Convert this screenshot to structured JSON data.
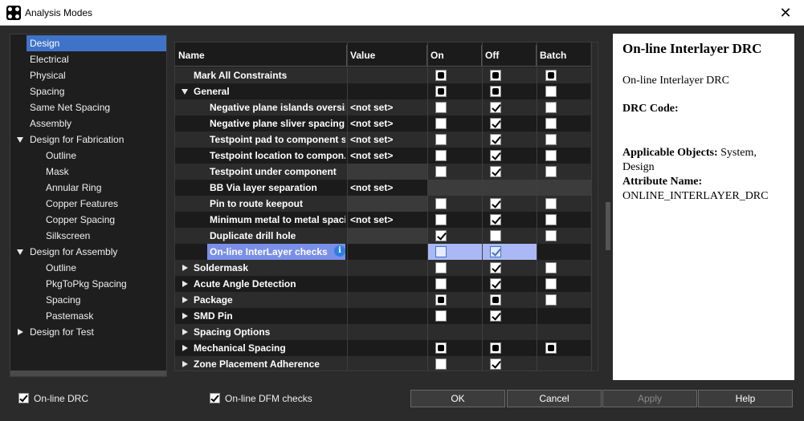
{
  "window": {
    "title": "Analysis Modes",
    "close_symbol": "✕"
  },
  "tree": {
    "items": [
      {
        "label": "Design",
        "level": 0,
        "expander": "none",
        "selected": true
      },
      {
        "label": "Electrical",
        "level": 0,
        "expander": "none"
      },
      {
        "label": "Physical",
        "level": 0,
        "expander": "none"
      },
      {
        "label": "Spacing",
        "level": 0,
        "expander": "none"
      },
      {
        "label": "Same Net Spacing",
        "level": 0,
        "expander": "none"
      },
      {
        "label": "Assembly",
        "level": 0,
        "expander": "none"
      },
      {
        "label": "Design for Fabrication",
        "level": 0,
        "expander": "expanded"
      },
      {
        "label": "Outline",
        "level": 1,
        "expander": "none"
      },
      {
        "label": "Mask",
        "level": 1,
        "expander": "none"
      },
      {
        "label": "Annular Ring",
        "level": 1,
        "expander": "none"
      },
      {
        "label": "Copper Features",
        "level": 1,
        "expander": "none"
      },
      {
        "label": "Copper Spacing",
        "level": 1,
        "expander": "none"
      },
      {
        "label": "Silkscreen",
        "level": 1,
        "expander": "none"
      },
      {
        "label": "Design for Assembly",
        "level": 0,
        "expander": "expanded"
      },
      {
        "label": "Outline",
        "level": 1,
        "expander": "none"
      },
      {
        "label": "PkgToPkg Spacing",
        "level": 1,
        "expander": "none"
      },
      {
        "label": "Spacing",
        "level": 1,
        "expander": "none"
      },
      {
        "label": "Pastemask",
        "level": 1,
        "expander": "none"
      },
      {
        "label": "Design for Test",
        "level": 0,
        "expander": "collapsed"
      }
    ]
  },
  "grid": {
    "columns": [
      "Name",
      "Value",
      "On",
      "Off",
      "Batch"
    ],
    "rows": [
      {
        "name": "Mark All Constraints",
        "indent": 1,
        "arrow": "none",
        "value": "",
        "on": "ind",
        "off": "ind",
        "batch": "ind"
      },
      {
        "name": "General",
        "indent": 1,
        "arrow": "down",
        "value": "",
        "on": "ind",
        "off": "ind",
        "batch": "empty"
      },
      {
        "name": "Negative plane islands oversize",
        "indent": 2,
        "arrow": "none",
        "value": "<not set>",
        "on": "empty",
        "off": "chk",
        "batch": "empty"
      },
      {
        "name": "Negative plane sliver spacing",
        "indent": 2,
        "arrow": "none",
        "value": "<not set>",
        "on": "empty",
        "off": "chk",
        "batch": "empty"
      },
      {
        "name": "Testpoint pad to component s...",
        "indent": 2,
        "arrow": "none",
        "value": "<not set>",
        "on": "empty",
        "off": "chk",
        "batch": "empty"
      },
      {
        "name": "Testpoint location to compon...",
        "indent": 2,
        "arrow": "none",
        "value": "<not set>",
        "on": "empty",
        "off": "chk",
        "batch": "empty"
      },
      {
        "name": "Testpoint under component",
        "indent": 2,
        "arrow": "none",
        "value": "",
        "on": "empty",
        "off": "chk",
        "batch": "empty",
        "value_shaded": true
      },
      {
        "name": "BB Via layer separation",
        "indent": 2,
        "arrow": "none",
        "value": "<not set>",
        "on": "none",
        "off": "none",
        "batch": "none",
        "cb_shaded": true
      },
      {
        "name": "Pin to route keepout",
        "indent": 2,
        "arrow": "none",
        "value": "",
        "on": "empty",
        "off": "chk",
        "batch": "empty",
        "value_shaded": true
      },
      {
        "name": "Minimum metal to metal spacing",
        "indent": 2,
        "arrow": "none",
        "value": "<not set>",
        "on": "empty",
        "off": "chk",
        "batch": "empty"
      },
      {
        "name": "Duplicate drill hole",
        "indent": 2,
        "arrow": "none",
        "value": "",
        "on": "chk",
        "off": "empty",
        "batch": "empty",
        "value_shaded": true
      },
      {
        "name": "On-line InterLayer checks",
        "indent": 2,
        "arrow": "none",
        "value": "",
        "on": "empty",
        "off": "chk",
        "batch": "none",
        "selected": true,
        "info_icon": "i"
      },
      {
        "name": "Soldermask",
        "indent": 1,
        "arrow": "right",
        "value": "",
        "on": "empty",
        "off": "chk",
        "batch": "empty"
      },
      {
        "name": "Acute Angle Detection",
        "indent": 1,
        "arrow": "right",
        "value": "",
        "on": "empty",
        "off": "chk",
        "batch": "empty"
      },
      {
        "name": "Package",
        "indent": 1,
        "arrow": "right",
        "value": "",
        "on": "ind",
        "off": "ind",
        "batch": "empty"
      },
      {
        "name": "SMD Pin",
        "indent": 1,
        "arrow": "right",
        "value": "",
        "on": "empty",
        "off": "chk",
        "batch": "none"
      },
      {
        "name": "Spacing Options",
        "indent": 1,
        "arrow": "right",
        "value": "",
        "on": "none",
        "off": "none",
        "batch": "none"
      },
      {
        "name": "Mechanical Spacing",
        "indent": 1,
        "arrow": "right",
        "value": "",
        "on": "ind",
        "off": "ind",
        "batch": "ind"
      },
      {
        "name": "Zone Placement Adherence",
        "indent": 1,
        "arrow": "right",
        "value": "",
        "on": "empty",
        "off": "chk",
        "batch": "none"
      }
    ]
  },
  "help": {
    "title": "On-line Interlayer DRC",
    "subtitle": "On-line Interlayer DRC",
    "drc_code_label": "DRC Code:",
    "applicable_label": "Applicable Objects:",
    "applicable_value": " System,",
    "applicable_value2": "Design",
    "attribute_label": "Attribute Name:",
    "attribute_value": "ONLINE_INTERLAYER_DRC"
  },
  "footer": {
    "online_drc": {
      "label": "On-line DRC",
      "checked": true
    },
    "online_dfm": {
      "label": "On-line DFM checks",
      "checked": true
    },
    "buttons": {
      "ok": "OK",
      "cancel": "Cancel",
      "apply": "Apply",
      "help": "Help"
    }
  },
  "colors": {
    "selection": "#3f73c8",
    "selected_row": "#7a8fe8",
    "info_icon": "#2f7fe0",
    "background": "#2b2b2b"
  }
}
